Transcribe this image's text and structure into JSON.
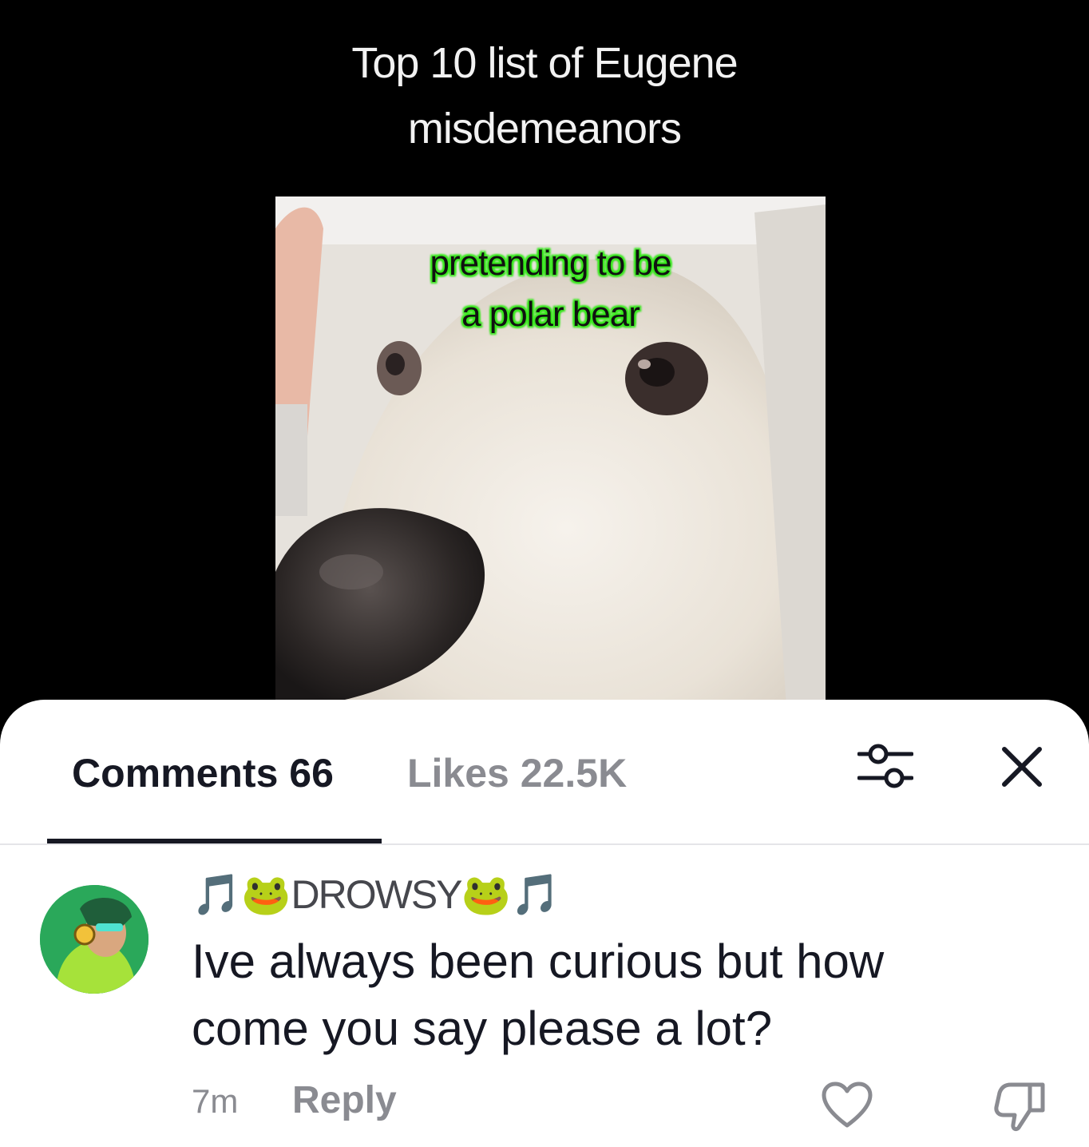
{
  "video": {
    "title_line1": "Top 10 list of Eugene",
    "title_line2": "misdemeanors",
    "caption_line1": "pretending to be",
    "caption_line2": "a polar bear",
    "caption_outline_color": "#37e81c"
  },
  "sheet": {
    "tabs": [
      {
        "label": "Comments 66",
        "active": true
      },
      {
        "label": "Likes 22.5K",
        "active": false
      }
    ],
    "filter_icon": "sliders-icon",
    "close_icon": "close-icon"
  },
  "comment": {
    "username": "DROWSY",
    "username_decor_left": "🎵🐸",
    "username_decor_right": "🐸🎵",
    "text_line1": "Ive always been curious but how",
    "text_line2": "come you say please a lot?",
    "time": "7m",
    "reply_label": "Reply",
    "like_icon": "heart-outline-icon",
    "dislike_icon": "thumbs-down-icon"
  }
}
